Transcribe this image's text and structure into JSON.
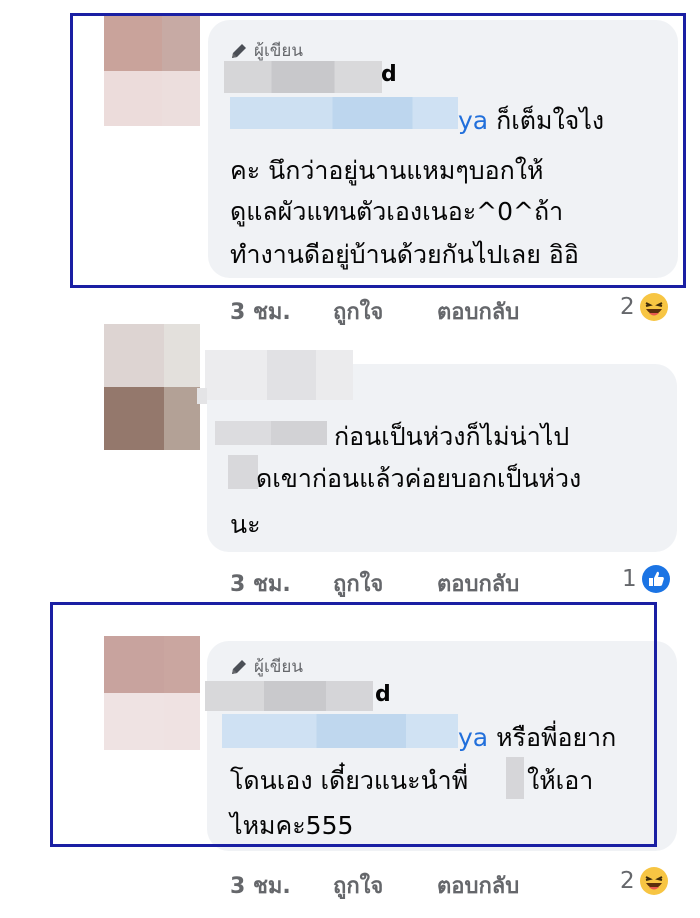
{
  "comments": [
    {
      "author_tag": "ผู้เขียน",
      "name_tail": "d",
      "mention_tail": "ya",
      "lines": [
        "ก็เต็มใจไง",
        "คะ นึกว่าอยู่นานแหมๆบอกให้",
        "ดูแลผัวแทนตัวเองเนอะ^0^ถ้า",
        "ทำงานดีอยู่บ้านด้วยกันไปเลย อิอิ"
      ],
      "time": "3 ชม.",
      "like": "ถูกใจ",
      "reply": "ตอบกลับ",
      "reaction_count": "2",
      "reaction_icon": "haha-icon"
    },
    {
      "lines": [
        "ก่อนเป็นห่วงก็ไม่น่าไป",
        "ดเขาก่อนแล้วค่อยบอกเป็นห่วง",
        "นะ"
      ],
      "time": "3 ชม.",
      "like": "ถูกใจ",
      "reply": "ตอบกลับ",
      "reaction_count": "1",
      "reaction_icon": "like-icon"
    },
    {
      "author_tag": "ผู้เขียน",
      "name_tail": "d",
      "mention_tail": "ya",
      "lines": [
        "หรือพี่อยาก",
        "โดนเอง เดี๋ยวแนะนำพี่",
        "ให้เอา",
        "ไหมคะ555"
      ],
      "time": "3 ชม.",
      "like": "ถูกใจ",
      "reply": "ตอบกลับ",
      "reaction_count": "2",
      "reaction_icon": "haha-icon"
    }
  ],
  "colors": {
    "highlight": "#1a1fa3",
    "mention": "#216fdb",
    "bubble": "#f0f2f5",
    "meta": "#65676b"
  }
}
